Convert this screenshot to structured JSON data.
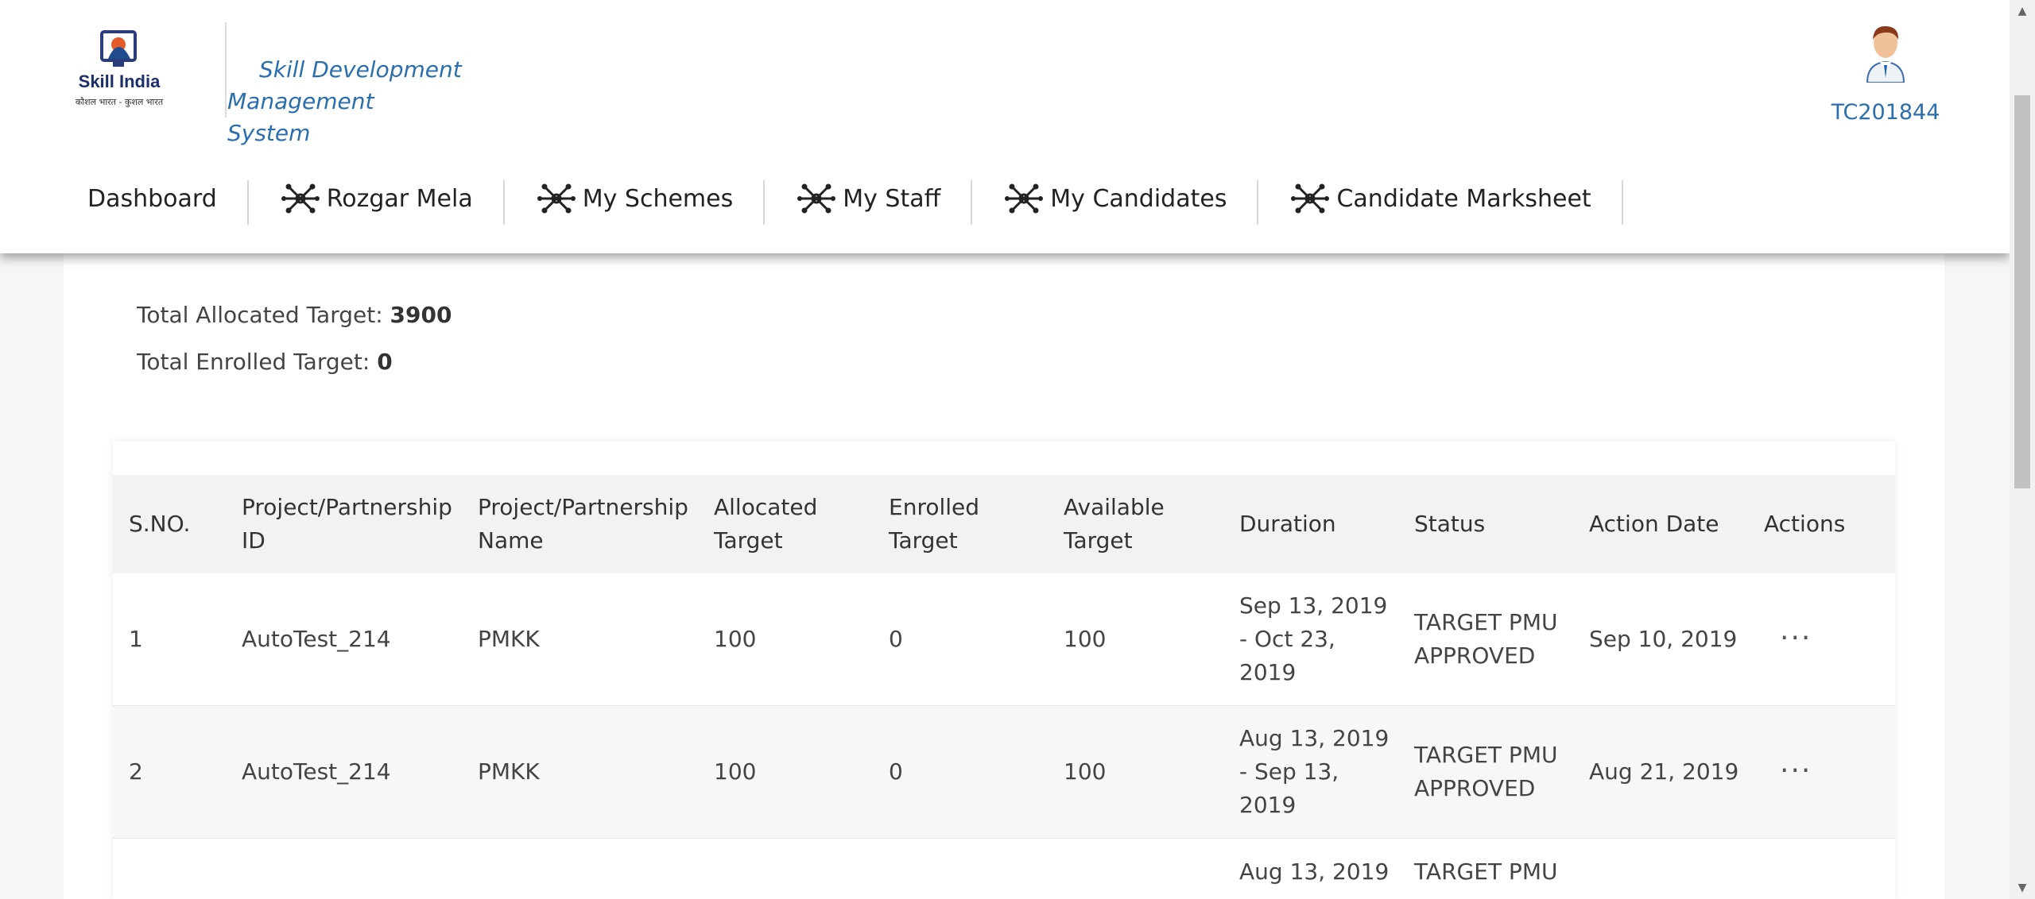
{
  "header": {
    "logo_text": "Skill India",
    "logo_subtext": "कौशल भारत - कुशल भारत",
    "app_title_line1": "Skill Development Management",
    "app_title_line2": "System",
    "user_id": "TC201844"
  },
  "nav": [
    {
      "label": "Dashboard",
      "icon": "none"
    },
    {
      "label": "Rozgar Mela",
      "icon": "network-icon"
    },
    {
      "label": "My Schemes",
      "icon": "network-icon"
    },
    {
      "label": "My Staff",
      "icon": "network-icon"
    },
    {
      "label": "My Candidates",
      "icon": "network-icon"
    },
    {
      "label": "Candidate Marksheet",
      "icon": "network-icon"
    }
  ],
  "summary": {
    "allocated_label": "Total Allocated Target:",
    "allocated_value": "3900",
    "enrolled_label": "Total Enrolled Target:",
    "enrolled_value": "0"
  },
  "table": {
    "headers": {
      "sno": "S.NO.",
      "project_id": "Project/Partnership ID",
      "project_name": "Project/Partnership Name",
      "allocated": "Allocated Target",
      "enrolled": "Enrolled Target",
      "available": "Available Target",
      "duration": "Duration",
      "status": "Status",
      "action_date": "Action Date",
      "actions": "Actions"
    },
    "rows": [
      {
        "sno": "1",
        "project_id": "AutoTest_214",
        "project_name": "PMKK",
        "allocated": "100",
        "enrolled": "0",
        "available": "100",
        "duration": "Sep 13, 2019 - Oct 23, 2019",
        "status": "TARGET PMU APPROVED",
        "action_date": "Sep 10, 2019",
        "actions": "···"
      },
      {
        "sno": "2",
        "project_id": "AutoTest_214",
        "project_name": "PMKK",
        "allocated": "100",
        "enrolled": "0",
        "available": "100",
        "duration": "Aug 13, 2019 - Sep 13, 2019",
        "status": "TARGET PMU APPROVED",
        "action_date": "Aug 21, 2019",
        "actions": "···"
      },
      {
        "sno": "",
        "project_id": "",
        "project_name": "",
        "allocated": "",
        "enrolled": "",
        "available": "",
        "duration": "Aug 13, 2019",
        "status": "TARGET PMU",
        "action_date": "",
        "actions": ""
      }
    ]
  },
  "colors": {
    "accent": "#2a6ead",
    "header_bg": "#ffffff",
    "table_header_bg": "#f2f2f2"
  }
}
